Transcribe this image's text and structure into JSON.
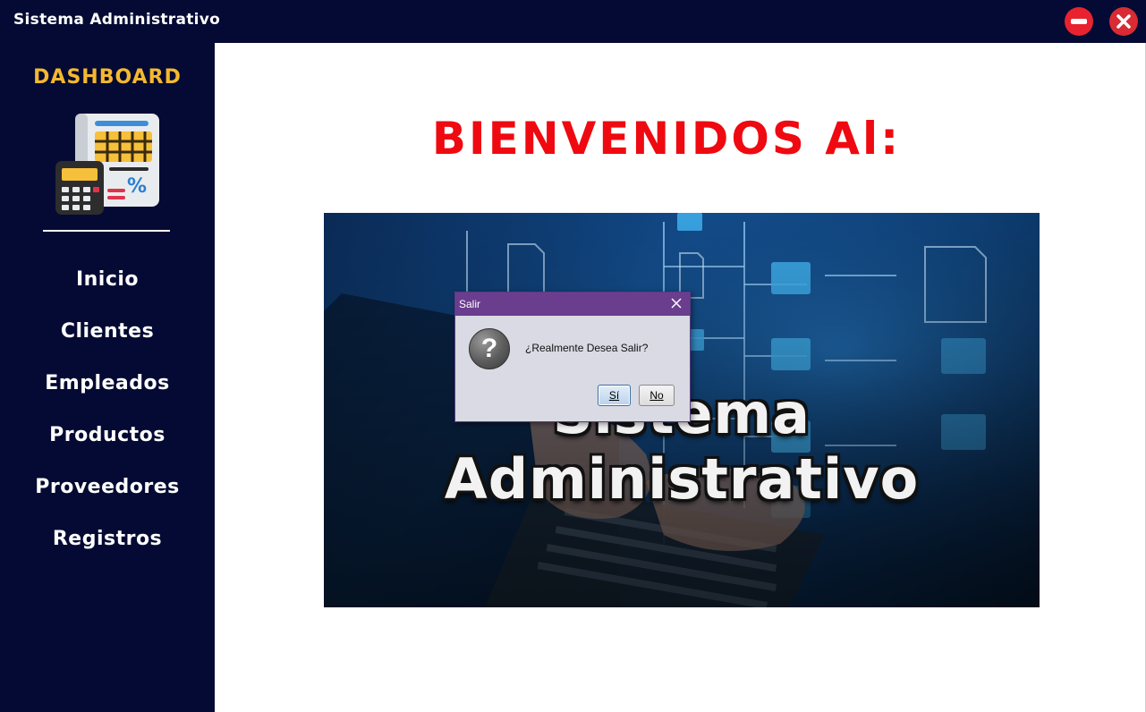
{
  "window": {
    "title": "Sistema Administrativo",
    "minimize_icon": "minus-circle-icon",
    "close_icon": "close-circle-icon"
  },
  "sidebar": {
    "heading": "DASHBOARD",
    "logo_icon": "accounting-calculator-icon",
    "items": [
      {
        "label": "Inicio"
      },
      {
        "label": "Clientes"
      },
      {
        "label": "Empleados"
      },
      {
        "label": "Productos"
      },
      {
        "label": "Proveedores"
      },
      {
        "label": "Registros"
      }
    ]
  },
  "main": {
    "welcome_text": "BIENVENIDOS Al:",
    "hero_text": "Sistema Administrativo"
  },
  "dialog": {
    "title": "Salir",
    "message": "¿Realmente Desea Salir?",
    "icon": "question-icon",
    "icon_glyph": "?",
    "yes_label": "Sí",
    "no_label": "No"
  },
  "colors": {
    "sidebar_bg": "#040a33",
    "heading_accent": "#f5b82e",
    "welcome_red": "#ee0a10",
    "dialog_title_bg": "#6b3d8f"
  }
}
